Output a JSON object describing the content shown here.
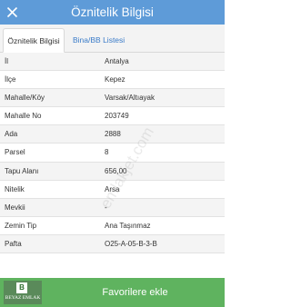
{
  "header": {
    "title": "Öznitelik Bilgisi",
    "close_icon": "close-icon"
  },
  "tabs": [
    {
      "label": "Öznitelik Bilgisi",
      "active": true
    },
    {
      "label": "Bina/BB Listesi",
      "active": false
    }
  ],
  "attributes": [
    {
      "label": "İl",
      "value": "Antalya"
    },
    {
      "label": "İlçe",
      "value": "Kepez"
    },
    {
      "label": "Mahalle/Köy",
      "value": "Varsak/Altıayak"
    },
    {
      "label": "Mahalle No",
      "value": "203749"
    },
    {
      "label": "Ada",
      "value": "2888"
    },
    {
      "label": "Parsel",
      "value": "8"
    },
    {
      "label": "Tapu Alanı",
      "value": "656,00"
    },
    {
      "label": "Nitelik",
      "value": "Arsa"
    },
    {
      "label": "Mevkii",
      "value": "-"
    },
    {
      "label": "Zemin Tip",
      "value": "Ana Taşınmaz"
    },
    {
      "label": "Pafta",
      "value": "O25-A-05-B-3-B"
    }
  ],
  "footer": {
    "logo_letter": "B",
    "logo_text": "BEYAZ EMLAK",
    "add_button_label": "Favorilere ekle"
  },
  "watermark": "emlakjet.com",
  "colors": {
    "header_bg": "#5e9bd8",
    "footer_bg": "#5fb35f",
    "tab_link": "#3a7bc8"
  }
}
